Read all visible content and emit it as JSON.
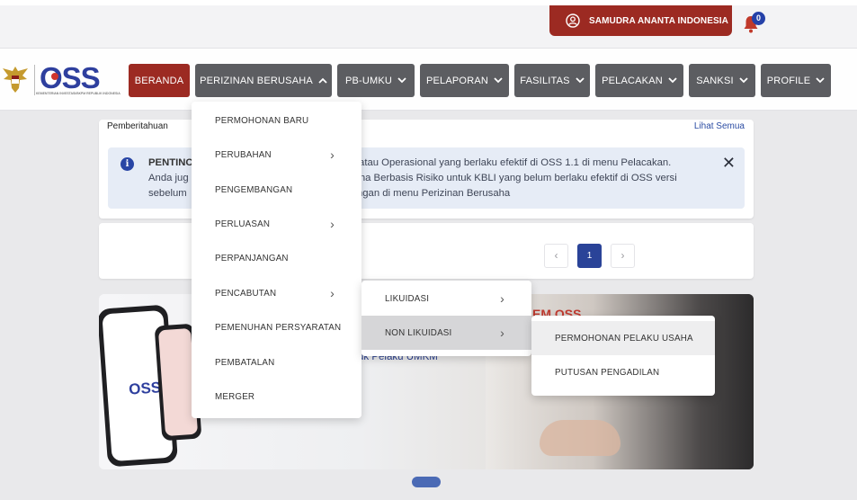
{
  "header": {
    "user_name": "SAMUDRA ANANTA INDONESIA",
    "notification_count": "0"
  },
  "logo": {
    "text": "OSS",
    "subtitle": "KEMENTERIAN INVESTASI/BKPM REPUBLIK INDONESIA"
  },
  "nav": {
    "beranda": "BERANDA",
    "perizinan": "PERIZINAN BERUSAHA",
    "pb_umku": "PB-UMKU",
    "pelaporan": "PELAPORAN",
    "fasilitas": "FASILITAS",
    "pelacakan": "PELACAKAN",
    "sanksi": "SANKSI",
    "profile": "PROFILE"
  },
  "notification": {
    "title": "Pemberitahuan",
    "see_all": "Lihat Semua",
    "alert_heading": "PENTINC",
    "alert_line1": "ial atau Operasional yang berlaku efektif di OSS 1.1 di menu Pelacakan.",
    "alert_line2_prefix": "Anda jug",
    "alert_line2": "usaha Berbasis Risiko untuk KBLI yang belum berlaku efektif di OSS versi",
    "alert_line3_prefix": "sebelum",
    "alert_line3": "angan di menu Perizinan Berusaha"
  },
  "pagination": {
    "prev": "‹",
    "current": "1",
    "next": "›"
  },
  "banner": {
    "text": "uk Pelaku UMKM",
    "heading_fragment": "EM OSS",
    "phone_logo": "OSS"
  },
  "dropdown_main": {
    "items": [
      {
        "label": "PERMOHONAN BARU"
      },
      {
        "label": "PERUBAHAN"
      },
      {
        "label": "PENGEMBANGAN"
      },
      {
        "label": "PERLUASAN"
      },
      {
        "label": "PERPANJANGAN"
      },
      {
        "label": "PENCABUTAN"
      },
      {
        "label": "PEMENUHAN PERSYARATAN"
      },
      {
        "label": "PEMBATALAN"
      },
      {
        "label": "MERGER"
      }
    ]
  },
  "dropdown_pencabutan": {
    "items": [
      {
        "label": "LIKUIDASI"
      },
      {
        "label": "NON LIKUIDASI"
      }
    ]
  },
  "dropdown_non_likuidasi": {
    "items": [
      {
        "label": "PERMOHONAN PELAKU USAHA"
      },
      {
        "label": "PUTUSAN PENGADILAN"
      }
    ]
  },
  "colors": {
    "brand_red": "#9c2a22",
    "nav_gray": "#5c5d61",
    "brand_blue": "#2a4398"
  }
}
